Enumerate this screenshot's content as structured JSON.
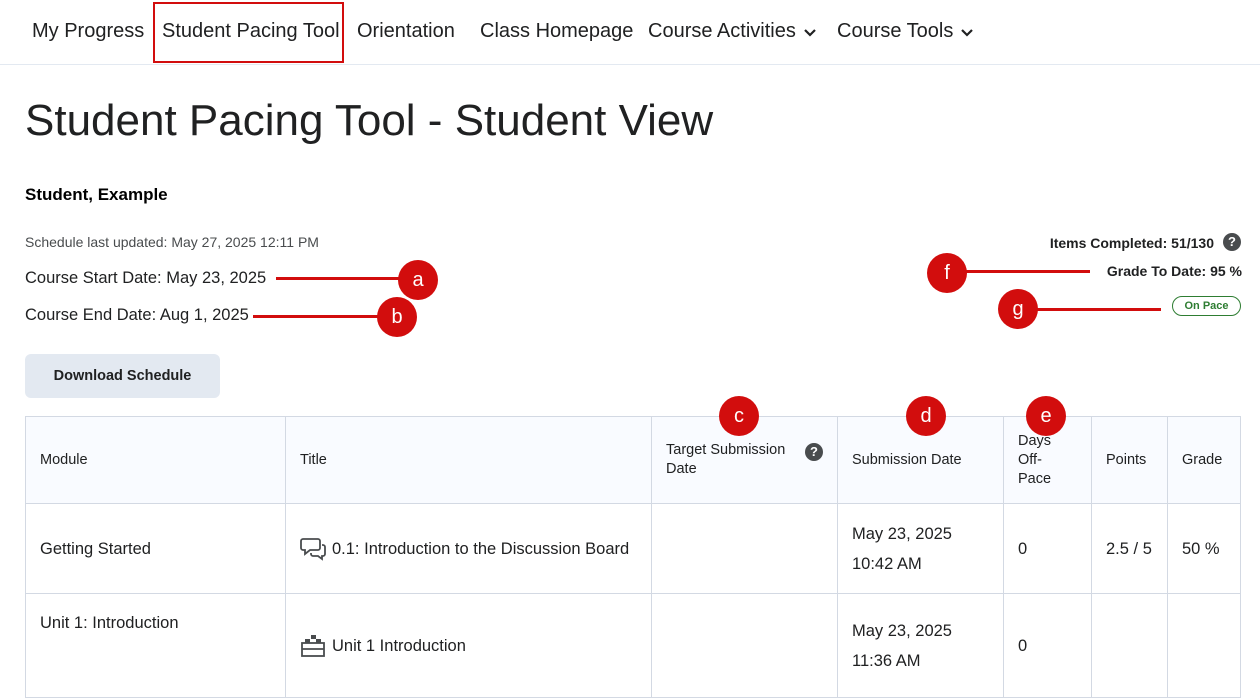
{
  "nav": {
    "items": [
      "My Progress",
      "Student Pacing Tool",
      "Orientation",
      "Class Homepage",
      "Course Activities",
      "Course Tools"
    ]
  },
  "page": {
    "title": "Student Pacing Tool - Student View",
    "student_name": "Student, Example",
    "schedule_updated": "Schedule last updated: May 27, 2025 12:11 PM",
    "course_start": "Course Start Date: May 23, 2025",
    "course_end": "Course End Date: Aug 1, 2025",
    "items_completed_label": "Items Completed:",
    "items_completed_value": "51/130",
    "grade_to_date": "Grade To Date: 95 %",
    "status_badge": "On Pace",
    "download_button": "Download Schedule"
  },
  "callouts": {
    "a": "a",
    "b": "b",
    "c": "c",
    "d": "d",
    "e": "e",
    "f": "f",
    "g": "g"
  },
  "table": {
    "headers": [
      "Module",
      "Title",
      "Target Submission Date",
      "Submission Date",
      "Days Off-Pace",
      "Points",
      "Grade"
    ],
    "rows": [
      {
        "module": "Getting Started",
        "title": "0.1: Introduction to the Discussion Board",
        "icon": "discussion-icon",
        "target_date": "",
        "submission_date": "May 23, 2025",
        "submission_time": "10:42 AM",
        "days_off_pace": "0",
        "points": "2.5 / 5",
        "grade": "50 %"
      },
      {
        "module": "Unit 1: Introduction",
        "title": "Unit 1 Introduction",
        "icon": "lego-block-icon",
        "target_date": "",
        "submission_date": "May 23, 2025",
        "submission_time": "11:36 AM",
        "days_off_pace": "0",
        "points": "",
        "grade": ""
      }
    ]
  },
  "colors": {
    "callout": "#d20d0d",
    "on_pace": "#2e7d32",
    "button_bg": "#e3e9f1"
  }
}
